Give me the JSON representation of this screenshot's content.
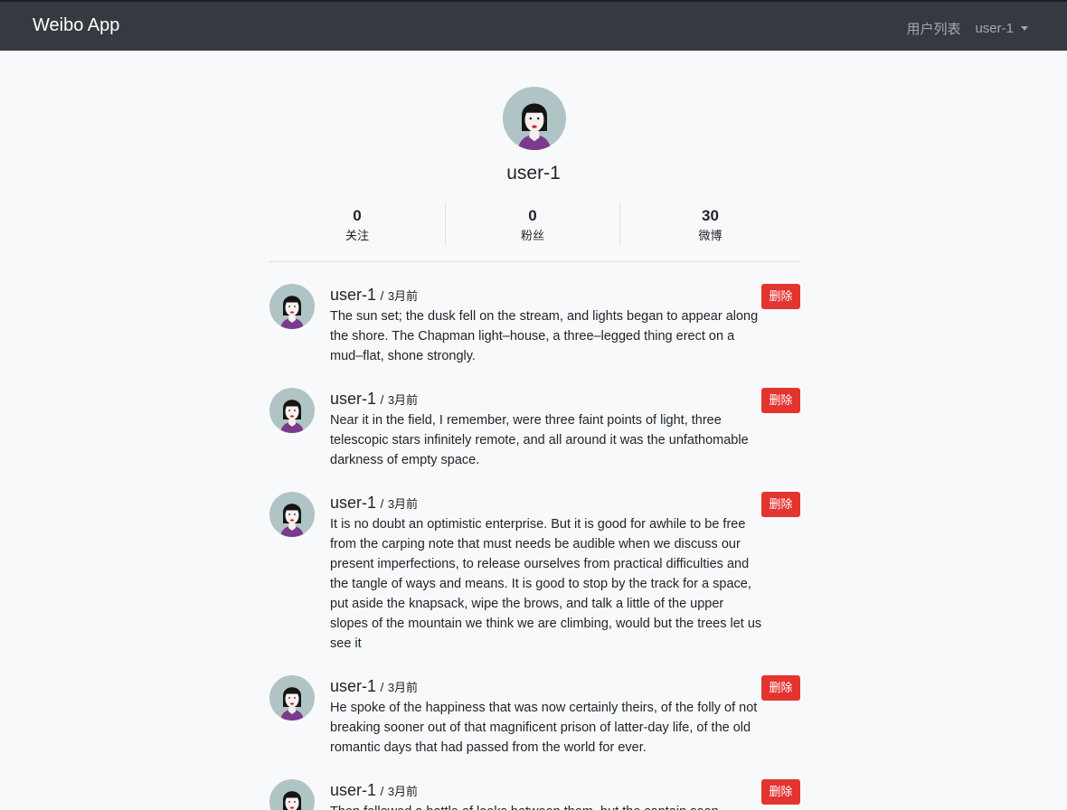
{
  "navbar": {
    "brand": "Weibo App",
    "users_link": "用户列表",
    "current_user": "user-1"
  },
  "profile": {
    "name": "user-1",
    "stats": [
      {
        "value": "0",
        "label": "关注"
      },
      {
        "value": "0",
        "label": "粉丝"
      },
      {
        "value": "30",
        "label": "微博"
      }
    ]
  },
  "posts": [
    {
      "user": "user-1",
      "sep": "/",
      "time": "3月前",
      "delete_label": "删除",
      "text": "The sun set; the dusk fell on the stream, and lights began to appear along the shore. The Chapman light–house, a three–legged thing erect on a mud–flat, shone strongly."
    },
    {
      "user": "user-1",
      "sep": "/",
      "time": "3月前",
      "delete_label": "删除",
      "text": "Near it in the field, I remember, were three faint points of light, three telescopic stars infinitely remote, and all around it was the unfathomable darkness of empty space."
    },
    {
      "user": "user-1",
      "sep": "/",
      "time": "3月前",
      "delete_label": "删除",
      "text": "It is no doubt an optimistic enterprise. But it is good for awhile to be free from the carping note that must needs be audible when we discuss our present imperfections, to release ourselves from practical difficulties and the tangle of ways and means. It is good to stop by the track for a space, put aside the knapsack, wipe the brows, and talk a little of the upper slopes of the mountain we think we are climbing, would but the trees let us see it"
    },
    {
      "user": "user-1",
      "sep": "/",
      "time": "3月前",
      "delete_label": "删除",
      "text": "He spoke of the happiness that was now certainly theirs, of the folly of not breaking sooner out of that magnificent prison of latter-day life, of the old romantic days that had passed from the world for ever."
    },
    {
      "user": "user-1",
      "sep": "/",
      "time": "3月前",
      "delete_label": "删除",
      "text": "Then followed a battle of looks between them, but the captain soon"
    }
  ],
  "colors": {
    "navbar_bg": "#343a40",
    "page_bg": "#f8f9fa",
    "delete_button": "#e3342f",
    "avatar_bg": "#b0c4c6",
    "avatar_shirt": "#7b3a8c",
    "avatar_lips": "#d21f2b"
  },
  "icons": {
    "avatar": "avatar-woman-icon",
    "dropdown": "caret-down-icon"
  }
}
